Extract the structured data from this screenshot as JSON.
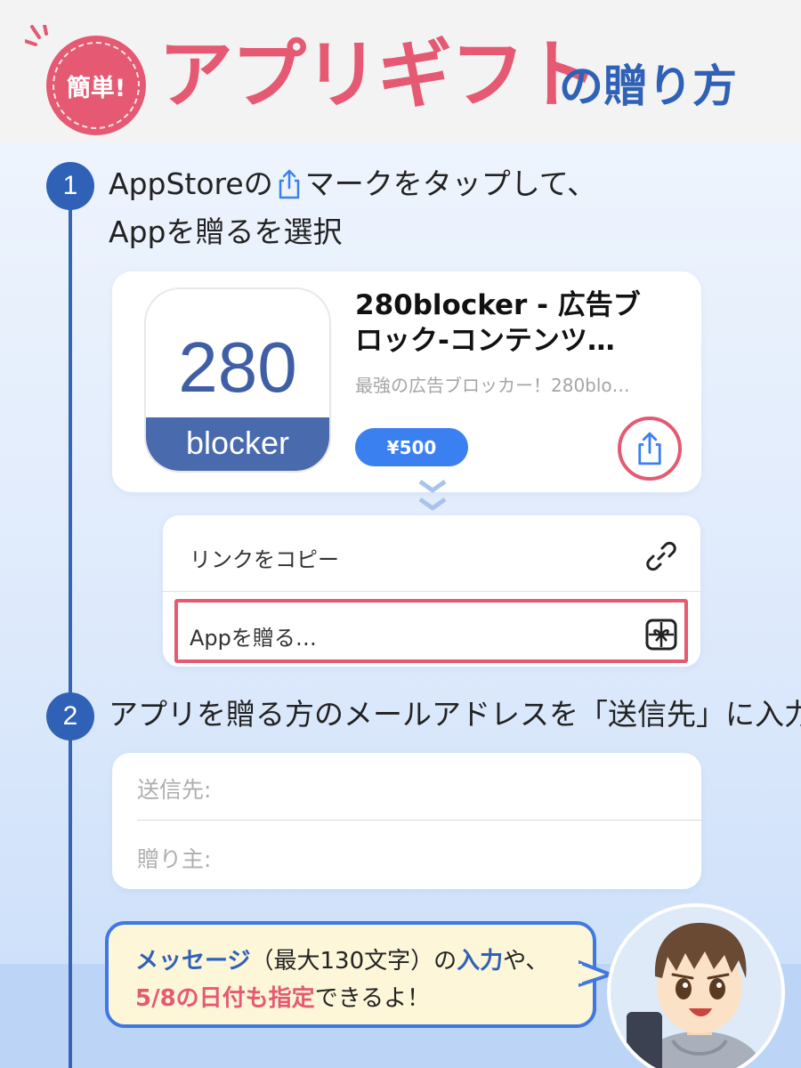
{
  "header": {
    "badge": "簡単!",
    "title_main": "アプリギフト",
    "title_sub": "の贈り方"
  },
  "steps": [
    {
      "number": "1",
      "text_before_icon": "AppStoreの",
      "text_after_icon": "マークをタップして、",
      "line2": "Appを贈るを選択"
    },
    {
      "number": "2",
      "text": "アプリを贈る方のメールアドレスを「送信先」に入力"
    }
  ],
  "app_card": {
    "icon_number": "280",
    "icon_label": "blocker",
    "title_line1": "280blocker - 広告ブ",
    "title_line2": "ロック-コンテンツ…",
    "subtitle": "最強の広告ブロッカー！280blo…",
    "price": "¥500"
  },
  "share_menu": {
    "items": [
      {
        "label": "リンクをコピー",
        "icon": "link-icon"
      },
      {
        "label": "Appを贈る…",
        "icon": "gift-icon"
      }
    ]
  },
  "form": {
    "recipient_label": "送信先:",
    "sender_label": "贈り主:"
  },
  "bubble": {
    "line1_a": "メッセージ",
    "line1_b": "（最大130文字）の",
    "line1_c": "入力",
    "line1_d": "や、",
    "line2_a": "5/8の日付も指定",
    "line2_b": "できるよ！"
  },
  "colors": {
    "accent_pink": "#e55a72",
    "accent_blue": "#2f62b6",
    "price_blue": "#3a80f1",
    "bubble_bg": "#fdf6d8"
  }
}
